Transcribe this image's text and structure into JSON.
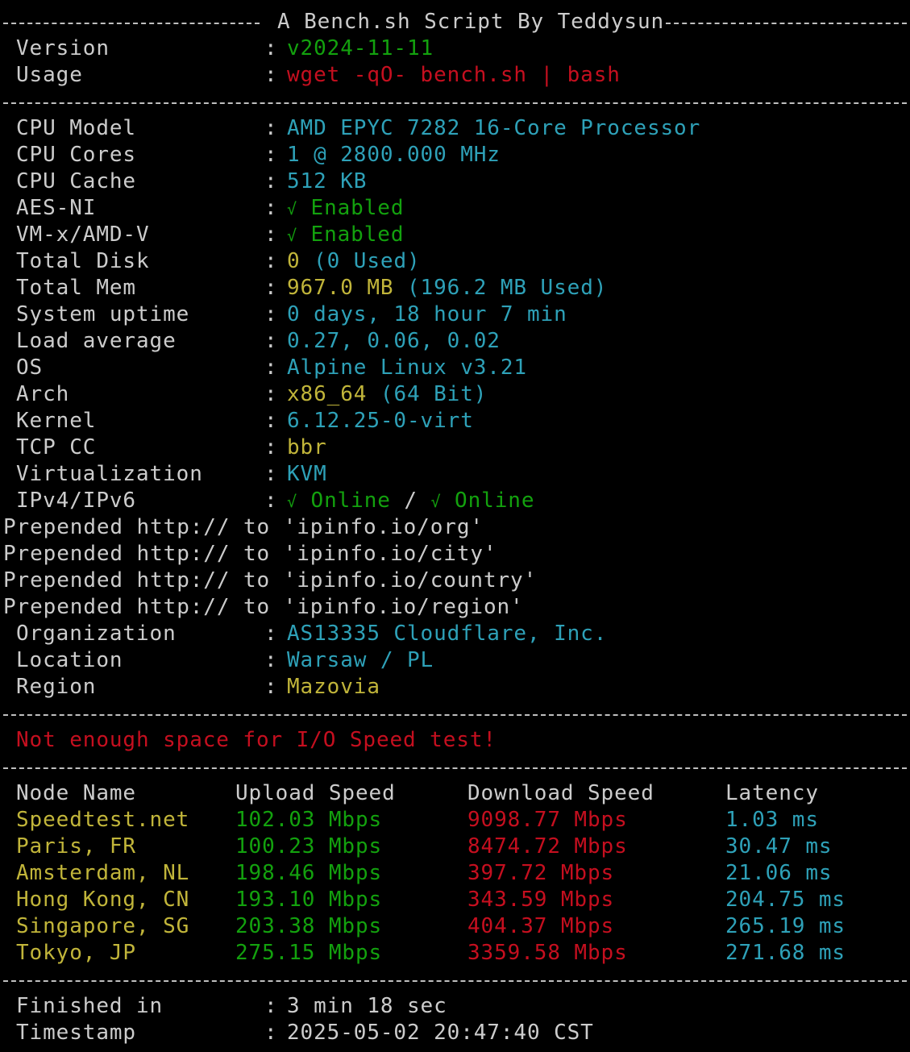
{
  "header": {
    "title": "A Bench.sh Script By Teddysun"
  },
  "colors": {
    "background": "#000000",
    "text": "#cccccc",
    "green": "#13a10e",
    "red": "#c50f1f",
    "cyan": "#3a96dd",
    "yellow": "#c1b53a"
  },
  "meta": {
    "version_label": "Version",
    "version_value": "v2024-11-11",
    "usage_label": "Usage",
    "usage_value": "wget -qO- bench.sh | bash"
  },
  "system": {
    "cpu_model_label": "CPU Model",
    "cpu_model": "AMD EPYC 7282 16-Core Processor",
    "cpu_cores_label": "CPU Cores",
    "cpu_cores": "1 @ 2800.000 MHz",
    "cpu_cache_label": "CPU Cache",
    "cpu_cache": "512 KB",
    "aes_label": "AES-NI",
    "aes_mark": "√",
    "aes_value": "Enabled",
    "vmx_label": "VM-x/AMD-V",
    "vmx_mark": "√",
    "vmx_value": "Enabled",
    "disk_label": "Total Disk",
    "disk_total": "0",
    "disk_used": "(0 Used)",
    "mem_label": "Total Mem",
    "mem_total": "967.0 MB",
    "mem_used": "(196.2 MB Used)",
    "uptime_label": "System uptime",
    "uptime": "0 days, 18 hour 7 min",
    "load_label": "Load average",
    "load": "0.27, 0.06, 0.02",
    "os_label": "OS",
    "os": "Alpine Linux v3.21",
    "arch_label": "Arch",
    "arch_value": "x86_64",
    "arch_bits": "(64 Bit)",
    "kernel_label": "Kernel",
    "kernel": "6.12.25-0-virt",
    "tcp_label": "TCP CC",
    "tcp": "bbr",
    "virt_label": "Virtualization",
    "virt": "KVM",
    "ip_label": "IPv4/IPv6",
    "ipv4_mark": "√",
    "ipv4_status": "Online",
    "ip_slash": "/",
    "ipv6_mark": "√",
    "ipv6_status": "Online"
  },
  "prepended": [
    {
      "text": "Prepended http:// to",
      "target": "'ipinfo.io/org'"
    },
    {
      "text": "Prepended http:// to",
      "target": "'ipinfo.io/city'"
    },
    {
      "text": "Prepended http:// to",
      "target": "'ipinfo.io/country'"
    },
    {
      "text": "Prepended http:// to",
      "target": "'ipinfo.io/region'"
    }
  ],
  "geo": {
    "org_label": "Organization",
    "org": "AS13335 Cloudflare, Inc.",
    "location_label": "Location",
    "location": "Warsaw / PL",
    "region_label": "Region",
    "region": "Mazovia"
  },
  "io": {
    "message": "Not enough space for I/O Speed test!"
  },
  "speedtest": {
    "headers": [
      "Node Name",
      "Upload Speed",
      "Download Speed",
      "Latency"
    ],
    "rows": [
      {
        "node": "Speedtest.net",
        "upload": "102.03 Mbps",
        "download": "9098.77 Mbps",
        "latency": "1.03 ms"
      },
      {
        "node": "Paris, FR",
        "upload": "100.23 Mbps",
        "download": "8474.72 Mbps",
        "latency": "30.47 ms"
      },
      {
        "node": "Amsterdam, NL",
        "upload": "198.46 Mbps",
        "download": "397.72 Mbps",
        "latency": "21.06 ms"
      },
      {
        "node": "Hong Kong, CN",
        "upload": "193.10 Mbps",
        "download": "343.59 Mbps",
        "latency": "204.75 ms"
      },
      {
        "node": "Singapore, SG",
        "upload": "203.38 Mbps",
        "download": "404.37 Mbps",
        "latency": "265.19 ms"
      },
      {
        "node": "Tokyo, JP",
        "upload": "275.15 Mbps",
        "download": "3359.58 Mbps",
        "latency": "271.68 ms"
      }
    ]
  },
  "footer": {
    "finished_label": "Finished in",
    "finished": "3 min 18 sec",
    "timestamp_label": "Timestamp",
    "timestamp": "2025-05-02 20:47:40 CST"
  },
  "separator": ":"
}
